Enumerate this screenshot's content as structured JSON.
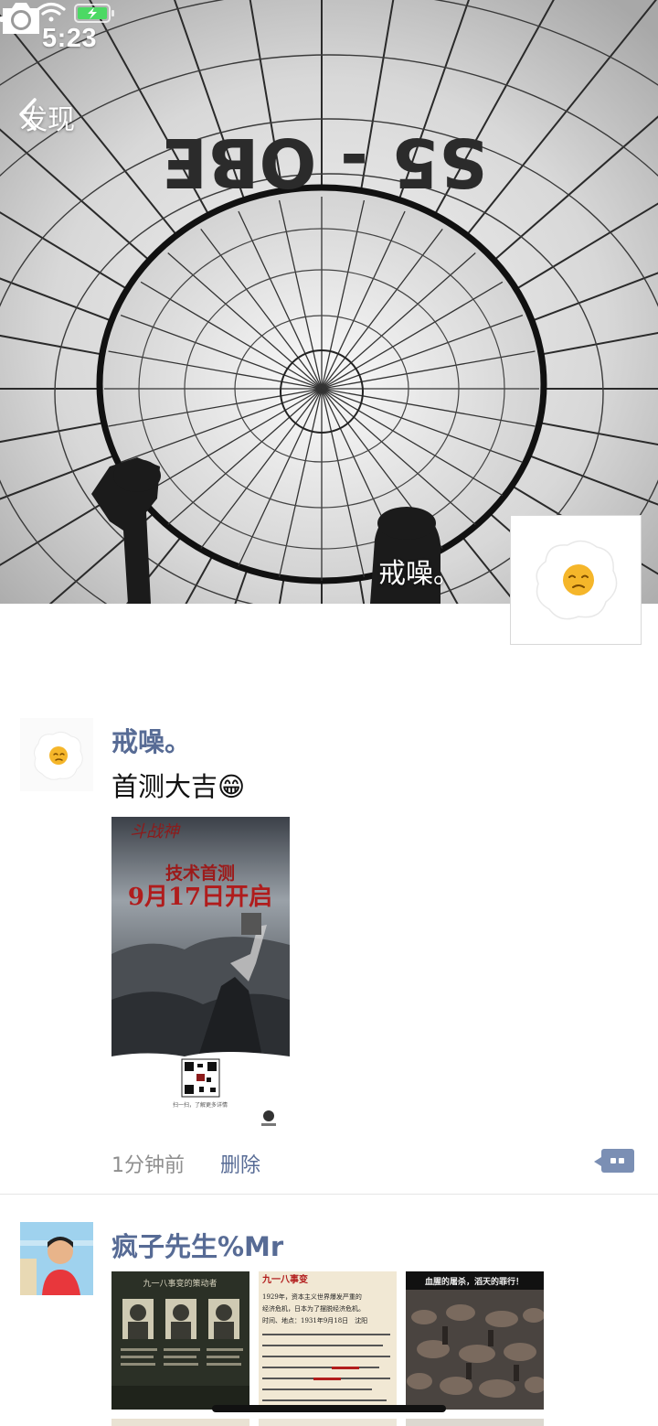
{
  "status_bar": {
    "time": "5:23"
  },
  "nav": {
    "back_label": "发现"
  },
  "cover": {
    "display_name": "戒噪。",
    "balloon_text": "S5 - OBE"
  },
  "posts": [
    {
      "name": "戒噪。",
      "text": "首测大吉😁",
      "poster": {
        "headline": "技术首测",
        "date": "9月17日开启",
        "caption": "扫一扫，了解更多详情"
      },
      "time": "1分钟前",
      "delete_label": "删除"
    },
    {
      "name": "疯子先生%Mr",
      "images": [
        {
          "title": "九一八事变的策动者"
        },
        {
          "title": "九一八事变",
          "line1": "1929年，资本主义世界爆发严重的",
          "line2": "经济危机，日本为了摆脱经济危机。",
          "line3": "时间、地点：1931年9月18日　沈阳"
        },
        {
          "title": "血腥的屠杀，滔天的罪行！"
        }
      ]
    }
  ]
}
